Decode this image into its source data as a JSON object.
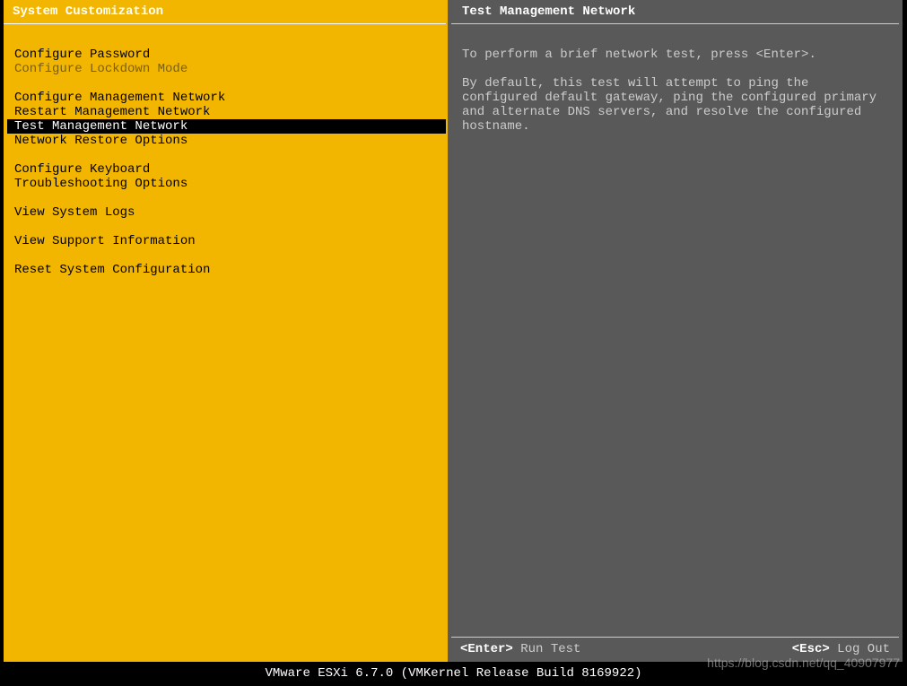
{
  "left": {
    "title": "System Customization",
    "groups": [
      [
        {
          "label": "Configure Password",
          "selected": false,
          "disabled": false
        },
        {
          "label": "Configure Lockdown Mode",
          "selected": false,
          "disabled": true
        }
      ],
      [
        {
          "label": "Configure Management Network",
          "selected": false,
          "disabled": false
        },
        {
          "label": "Restart Management Network",
          "selected": false,
          "disabled": false
        },
        {
          "label": "Test Management Network",
          "selected": true,
          "disabled": false
        },
        {
          "label": "Network Restore Options",
          "selected": false,
          "disabled": false
        }
      ],
      [
        {
          "label": "Configure Keyboard",
          "selected": false,
          "disabled": false
        },
        {
          "label": "Troubleshooting Options",
          "selected": false,
          "disabled": false
        }
      ],
      [
        {
          "label": "View System Logs",
          "selected": false,
          "disabled": false
        }
      ],
      [
        {
          "label": "View Support Information",
          "selected": false,
          "disabled": false
        }
      ],
      [
        {
          "label": "Reset System Configuration",
          "selected": false,
          "disabled": false
        }
      ]
    ]
  },
  "right": {
    "title": "Test Management Network",
    "para1": "To perform a brief network test, press <Enter>.",
    "para2": "By default, this test will attempt to ping the configured default gateway, ping the configured primary and alternate DNS servers, and resolve the configured hostname.",
    "footer": {
      "enter_key": "<Enter>",
      "enter_label": " Run Test",
      "esc_key": "<Esc>",
      "esc_label": " Log Out"
    }
  },
  "bottom": "VMware ESXi 6.7.0 (VMKernel Release Build 8169922)",
  "watermark": "https://blog.csdn.net/qq_40907977"
}
